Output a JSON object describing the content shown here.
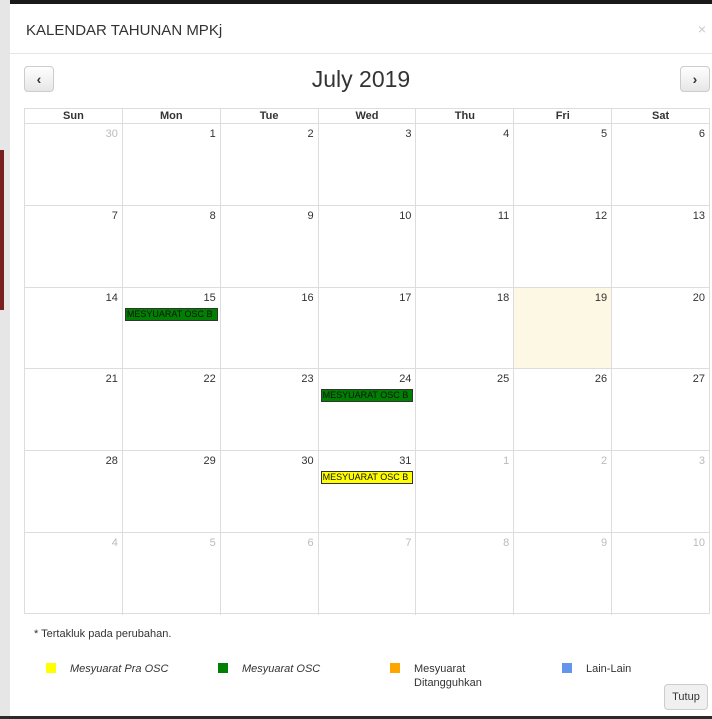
{
  "modal": {
    "title": "KALENDAR TAHUNAN MPKj",
    "close_glyph": "×"
  },
  "toolbar": {
    "prev_glyph": "‹",
    "next_glyph": "›",
    "title": "July 2019"
  },
  "colors": {
    "today_bg": "#fcf8e3",
    "pra_osc": "#ffff00",
    "osc": "#008000",
    "ditangguhkan": "#ffa500",
    "lain_lain": "#6495ed"
  },
  "calendar": {
    "days_of_week": [
      "Sun",
      "Mon",
      "Tue",
      "Wed",
      "Thu",
      "Fri",
      "Sat"
    ],
    "weeks": [
      [
        {
          "day": "30",
          "other": true
        },
        {
          "day": "1"
        },
        {
          "day": "2"
        },
        {
          "day": "3"
        },
        {
          "day": "4"
        },
        {
          "day": "5"
        },
        {
          "day": "6"
        }
      ],
      [
        {
          "day": "7"
        },
        {
          "day": "8"
        },
        {
          "day": "9"
        },
        {
          "day": "10"
        },
        {
          "day": "11"
        },
        {
          "day": "12"
        },
        {
          "day": "13"
        }
      ],
      [
        {
          "day": "14"
        },
        {
          "day": "15",
          "event": {
            "label": "MESYUARAT OSC B",
            "color": "#008000"
          }
        },
        {
          "day": "16"
        },
        {
          "day": "17"
        },
        {
          "day": "18"
        },
        {
          "day": "19",
          "today": true
        },
        {
          "day": "20"
        }
      ],
      [
        {
          "day": "21"
        },
        {
          "day": "22"
        },
        {
          "day": "23"
        },
        {
          "day": "24",
          "event": {
            "label": "MESYUARAT OSC B",
            "color": "#008000"
          }
        },
        {
          "day": "25"
        },
        {
          "day": "26"
        },
        {
          "day": "27"
        }
      ],
      [
        {
          "day": "28"
        },
        {
          "day": "29"
        },
        {
          "day": "30"
        },
        {
          "day": "31",
          "event": {
            "label": "MESYUARAT OSC B",
            "color": "#ffff00"
          }
        },
        {
          "day": "1",
          "other": true
        },
        {
          "day": "2",
          "other": true
        },
        {
          "day": "3",
          "other": true
        }
      ],
      [
        {
          "day": "4",
          "other": true
        },
        {
          "day": "5",
          "other": true
        },
        {
          "day": "6",
          "other": true
        },
        {
          "day": "7",
          "other": true
        },
        {
          "day": "8",
          "other": true
        },
        {
          "day": "9",
          "other": true
        },
        {
          "day": "10",
          "other": true
        }
      ]
    ]
  },
  "footer": {
    "note": "* Tertakluk pada perubahan.",
    "legend": [
      {
        "label": "Mesyuarat Pra OSC",
        "color": "#ffff00",
        "italic": true
      },
      {
        "label": "Mesyuarat OSC",
        "color": "#008000",
        "italic": true
      },
      {
        "label": "Mesyuarat\nDitangguhkan",
        "color": "#ffa500",
        "italic": false
      },
      {
        "label": "Lain-Lain",
        "color": "#6495ed",
        "italic": false
      }
    ],
    "close_label": "Tutup"
  }
}
